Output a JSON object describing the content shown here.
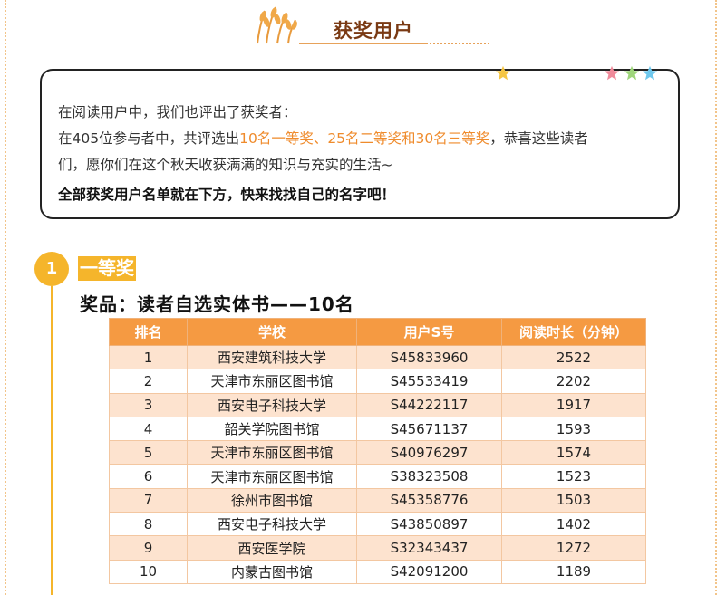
{
  "header": {
    "title": "获奖用户"
  },
  "info_box": {
    "line1": "在阅读用户中，我们也评出了获奖者：",
    "line2_pre": "在405位参与者中，共评选出",
    "line2_highlight": "10名一等奖、25名二等奖和30名三等奖",
    "line2_post": "，恭喜这些读者",
    "line3": "们，愿你们在这个秋天收获满满的知识与充实的生活~",
    "bold_line": "全部获奖用户名单就在下方，快来找找自己的名字吧！"
  },
  "section": {
    "number": "1",
    "title": "一等奖",
    "prize": "奖品：读者自选实体书——10名"
  },
  "table": {
    "headers": [
      "排名",
      "学校",
      "用户S号",
      "阅读时长（分钟）"
    ],
    "rows": [
      [
        "1",
        "西安建筑科技大学",
        "S45833960",
        "2522"
      ],
      [
        "2",
        "天津市东丽区图书馆",
        "S45533419",
        "2202"
      ],
      [
        "3",
        "西安电子科技大学",
        "S44222117",
        "1917"
      ],
      [
        "4",
        "韶关学院图书馆",
        "S45671137",
        "1593"
      ],
      [
        "5",
        "天津市东丽区图书馆",
        "S40976297",
        "1574"
      ],
      [
        "6",
        "天津市东丽区图书馆",
        "S38323508",
        "1523"
      ],
      [
        "7",
        "徐州市图书馆",
        "S45358776",
        "1503"
      ],
      [
        "8",
        "西安电子科技大学",
        "S43850897",
        "1402"
      ],
      [
        "9",
        "西安医学院",
        "S32343437",
        "1272"
      ],
      [
        "10",
        "内蒙古图书馆",
        "S42091200",
        "1189"
      ]
    ]
  },
  "colors": {
    "accent_orange": "#f59a42",
    "badge_yellow": "#f5b52b",
    "title_brown": "#7a3a14",
    "highlight_text": "#ef8b2c"
  },
  "icons": [
    "wheat-icon",
    "star-icon-yellow",
    "star-icon-pink",
    "star-icon-green",
    "star-icon-blue"
  ]
}
